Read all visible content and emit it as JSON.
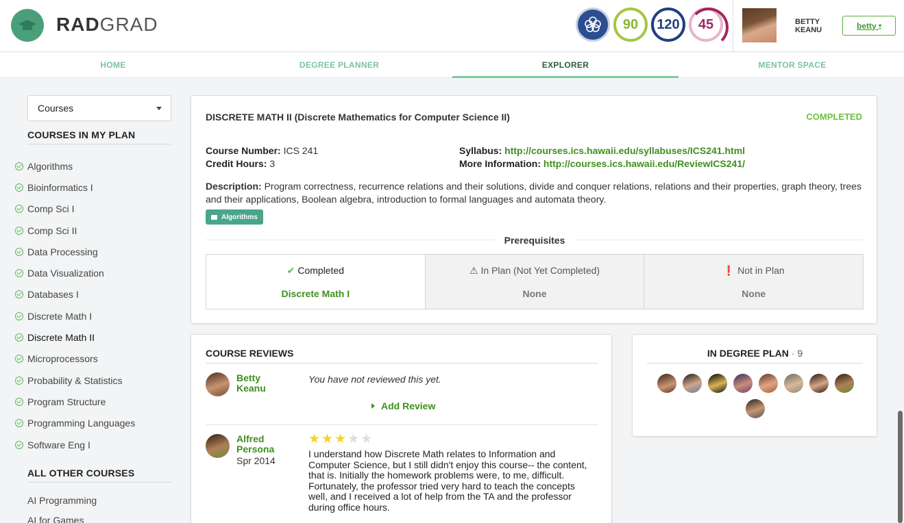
{
  "header": {
    "logo_bold": "RAD",
    "logo_regular": "GRAD",
    "scores": {
      "green": "90",
      "blue": "120",
      "purple": "45"
    },
    "user_name": "BETTY KEANU",
    "user_menu_label": "betty"
  },
  "nav": {
    "items": [
      {
        "label": "HOME"
      },
      {
        "label": "DEGREE PLANNER"
      },
      {
        "label": "EXPLORER"
      },
      {
        "label": "MENTOR SPACE"
      }
    ],
    "active": "EXPLORER"
  },
  "sidebar": {
    "select_value": "Courses",
    "plan_heading": "COURSES IN MY PLAN",
    "plan_courses": [
      "Algorithms",
      "Bioinformatics I",
      "Comp Sci I",
      "Comp Sci II",
      "Data Processing",
      "Data Visualization",
      "Databases I",
      "Discrete Math I",
      "Discrete Math II",
      "Microprocessors",
      "Probability & Statistics",
      "Program Structure",
      "Programming Languages",
      "Software Eng I"
    ],
    "current_course": "Discrete Math II",
    "other_heading": "ALL OTHER COURSES",
    "other_courses": [
      "AI Programming",
      "AI for Games"
    ]
  },
  "course": {
    "title": "DISCRETE MATH II (Discrete Mathematics for Computer Science II)",
    "status": "COMPLETED",
    "number_label": "Course Number:",
    "number": "ICS 241",
    "credit_label": "Credit Hours:",
    "credits": "3",
    "syllabus_label": "Syllabus:",
    "syllabus_url": "http://courses.ics.hawaii.edu/syllabuses/ICS241.html",
    "more_label": "More Information:",
    "more_url": "http://courses.ics.hawaii.edu/ReviewICS241/",
    "description_label": "Description:",
    "description": "Program correctness, recurrence relations and their solutions, divide and conquer relations, relations and their properties, graph theory, trees and their applications, Boolean algebra, introduction to formal languages and automata theory.",
    "tag": "Algorithms",
    "prereq_heading": "Prerequisites",
    "prereq": {
      "completed_label": "Completed",
      "completed_value": "Discrete Math I",
      "inplan_label": "In Plan (Not Yet Completed)",
      "inplan_value": "None",
      "notinplan_label": "Not in Plan",
      "notinplan_value": "None"
    }
  },
  "reviews": {
    "heading": "COURSE REVIEWS",
    "mine": {
      "name_first": "Betty",
      "name_last": "Keanu",
      "text": "You have not reviewed this yet.",
      "add_label": "Add Review"
    },
    "other": {
      "name_first": "Alfred",
      "name_last": "Persona",
      "semester": "Spr 2014",
      "rating": 3,
      "max_rating": 5,
      "text": "I understand how Discrete Math relates to Information and Computer Science, but I still didn't enjoy this course-- the content, that is. Initially the homework problems were, to me, difficult. Fortunately, the professor tried very hard to teach the concepts well, and I received a lot of help from the TA and the professor during office hours."
    }
  },
  "degree_plan": {
    "heading": "IN DEGREE PLAN",
    "separator": "·",
    "count": "9"
  },
  "colors": {
    "accent_green": "#3f8f1e",
    "nav_green": "#7bc39e",
    "tag_teal": "#4aa58a"
  }
}
